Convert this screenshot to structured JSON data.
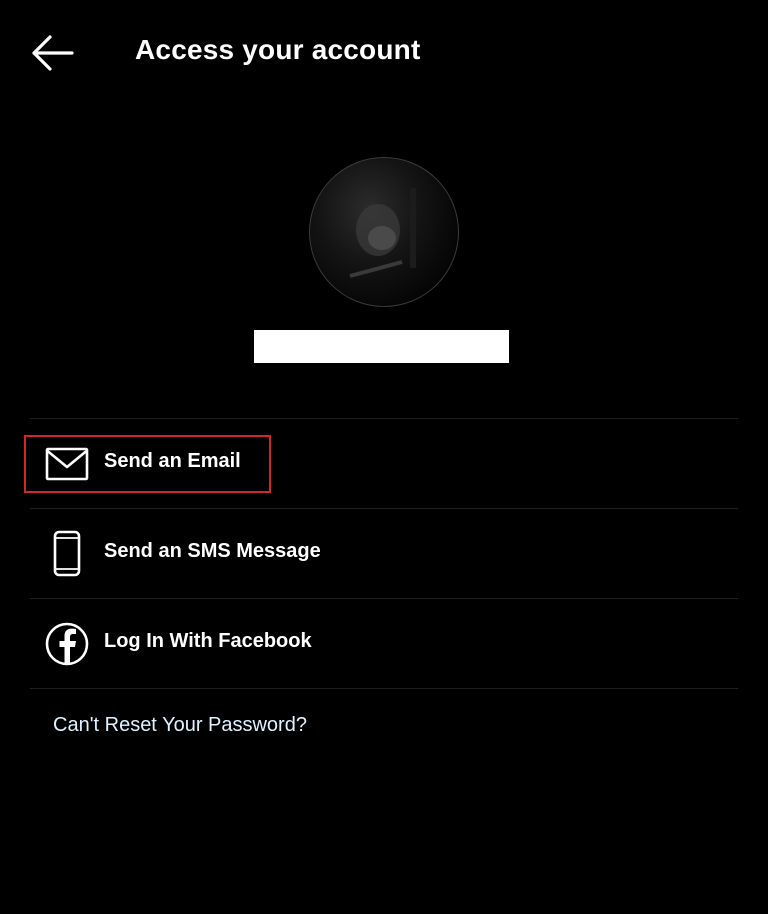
{
  "header": {
    "back_icon": "arrow-left-icon",
    "title": "Access your account"
  },
  "profile": {
    "avatar_icon": "profile-photo",
    "username_redacted": true
  },
  "options": [
    {
      "label": "Send an Email",
      "icon": "envelope-icon",
      "highlighted": true
    },
    {
      "label": "Send an SMS Message",
      "icon": "smartphone-icon"
    },
    {
      "label": "Log In With Facebook",
      "icon": "facebook-icon"
    }
  ],
  "links": {
    "cant_reset": "Can't Reset Your Password?"
  },
  "colors": {
    "background": "#000000",
    "text": "#ffffff",
    "link": "#e0f1ff",
    "highlight_border": "#d0262c",
    "divider": "#1f1f1f"
  }
}
